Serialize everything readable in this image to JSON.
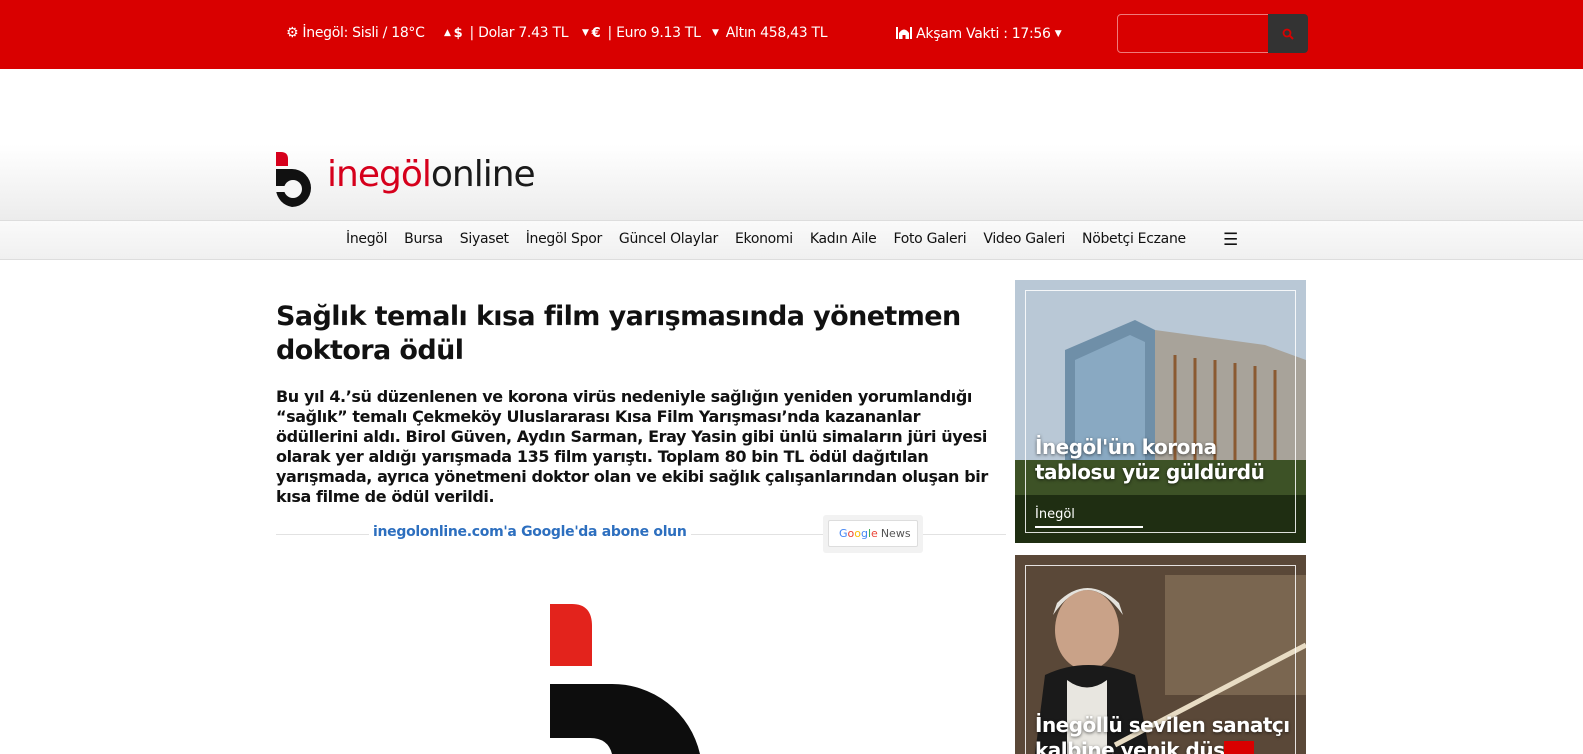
{
  "topbar": {
    "weather": "İnegöl: Sisli / 18°C",
    "dollar": "| Dolar 7.43 TL",
    "euro": "| Euro 9.13 TL",
    "gold": "Altın 458,43 TL",
    "prayer": "Akşam Vakti : 17:56",
    "dollar_icon": "$",
    "euro_icon": "€",
    "icons": [
      "gear-icon",
      "caret-up-icon",
      "caret-down-icon",
      "mosque-icon",
      "search-icon"
    ]
  },
  "brand": {
    "name_red": "inegöl",
    "name_dark": "online",
    "color_red": "#d90000"
  },
  "nav": {
    "items": [
      "İnegöl",
      "Bursa",
      "Siyaset",
      "İnegöl Spor",
      "Güncel Olaylar",
      "Ekonomi",
      "Kadın Aile",
      "Foto Galeri",
      "Video Galeri",
      "Nöbetçi Eczane"
    ],
    "menu_icon": "☰"
  },
  "article": {
    "headline": "Sağlık temalı kısa film yarışmasında yönetmen doktora ödül",
    "summary": "Bu yıl 4.’sü düzenlenen ve korona virüs nedeniyle sağlığın yeniden yorumlandığı “sağlık” temalı Çekmeköy Uluslararası Kısa Film Yarışması’nda kazananlar ödüllerini aldı. Birol Güven, Aydın Sarman, Eray Yasin gibi ünlü simaların jüri üyesi olarak yer aldığı yarışmada 135 film yarıştı. Toplam 80 bin TL ödül dağıtılan yarışmada, ayrıca yönetmeni doktor olan ve ekibi sağlık çalışanlarından oluşan bir kısa filme de ödül verildi."
  },
  "google_news": {
    "link": "inegolonline.com'a Google'da abone olun",
    "badge_google": [
      "G",
      "o",
      "o",
      "g",
      "l",
      "e"
    ],
    "badge_news": "News"
  },
  "sidebar": {
    "cards": [
      {
        "title": "İnegöl'ün korona tablosu yüz güldürdü",
        "category": "İnegöl"
      },
      {
        "title": "İnegöllü sevilen sanatçı kalbine yenik düştü",
        "category": ""
      }
    ]
  }
}
